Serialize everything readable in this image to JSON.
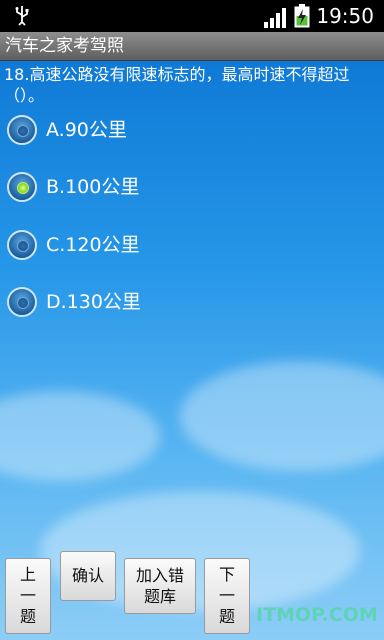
{
  "status_bar": {
    "time": "19:50",
    "icons": [
      "usb-icon",
      "signal-icon",
      "battery-charging-icon"
    ]
  },
  "app": {
    "title": "汽车之家考驾照"
  },
  "question": {
    "text": "18.高速公路没有限速标志的，最高时速不得超过（）。",
    "options": [
      {
        "label": "A.90公里",
        "selected": false
      },
      {
        "label": "B.100公里",
        "selected": true
      },
      {
        "label": "C.120公里",
        "selected": false
      },
      {
        "label": "D.130公里",
        "selected": false
      }
    ]
  },
  "buttons": {
    "prev": [
      "上",
      "一",
      "题"
    ],
    "confirm": "确认",
    "add_wrong": [
      "加入错",
      "题库"
    ],
    "next": [
      "下",
      "一",
      "题"
    ]
  },
  "watermark": "ITMOP.COM",
  "colors": {
    "sky_top": "#0f7ad6",
    "sky_bottom": "#8ccdf7",
    "selected_radio": "#8fd61c",
    "watermark": "#5fd3b7"
  }
}
